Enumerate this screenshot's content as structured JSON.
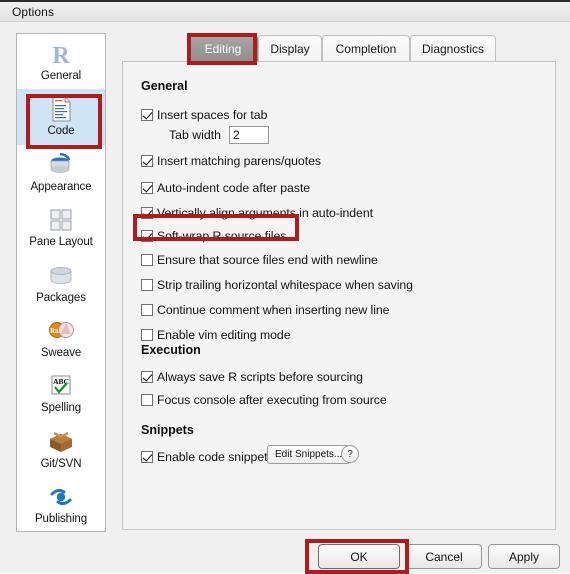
{
  "window": {
    "title": "Options"
  },
  "sidebar": {
    "items": [
      {
        "label": "General",
        "icon": "r-logo-icon",
        "selected": false
      },
      {
        "label": "Code",
        "icon": "document-icon",
        "selected": true
      },
      {
        "label": "Appearance",
        "icon": "paint-can-icon",
        "selected": false
      },
      {
        "label": "Pane Layout",
        "icon": "grid-icon",
        "selected": false
      },
      {
        "label": "Packages",
        "icon": "package-icon",
        "selected": false
      },
      {
        "label": "Sweave",
        "icon": "rnw-pdf-icon",
        "selected": false
      },
      {
        "label": "Spelling",
        "icon": "abc-check-icon",
        "selected": false
      },
      {
        "label": "Git/SVN",
        "icon": "box-icon",
        "selected": false
      },
      {
        "label": "Publishing",
        "icon": "publish-icon",
        "selected": false
      }
    ]
  },
  "tabs": [
    {
      "label": "Editing",
      "active": true
    },
    {
      "label": "Display",
      "active": false
    },
    {
      "label": "Completion",
      "active": false
    },
    {
      "label": "Diagnostics",
      "active": false
    }
  ],
  "panel": {
    "groups": {
      "general": "General",
      "execution": "Execution",
      "snippets": "Snippets"
    },
    "general_options": [
      {
        "label": "Insert spaces for tab",
        "checked": true
      },
      {
        "label": "Insert matching parens/quotes",
        "checked": true
      },
      {
        "label": "Auto-indent code after paste",
        "checked": true
      },
      {
        "label": "Vertically align arguments in auto-indent",
        "checked": true
      },
      {
        "label": "Soft-wrap R source files",
        "checked": true
      },
      {
        "label": "Ensure that source files end with newline",
        "checked": false
      },
      {
        "label": "Strip trailing horizontal whitespace when saving",
        "checked": false
      },
      {
        "label": "Continue comment when inserting new line",
        "checked": false
      },
      {
        "label": "Enable vim editing mode",
        "checked": false
      }
    ],
    "tab_width": {
      "label": "Tab width",
      "value": "2"
    },
    "execution_options": [
      {
        "label": "Always save R scripts before sourcing",
        "checked": true
      },
      {
        "label": "Focus console after executing from source",
        "checked": false
      }
    ],
    "snippets_options": [
      {
        "label": "Enable code snippets",
        "checked": true
      }
    ],
    "edit_snippets_label": "Edit Snippets...",
    "help_label": "?"
  },
  "buttons": {
    "ok": "OK",
    "cancel": "Cancel",
    "apply": "Apply"
  },
  "annotations": {
    "color": "#b21b1b",
    "highlighted": [
      "tab-editing",
      "sidebar-item-code",
      "checkbox-soft-wrap-r-source-files",
      "ok-button"
    ]
  }
}
